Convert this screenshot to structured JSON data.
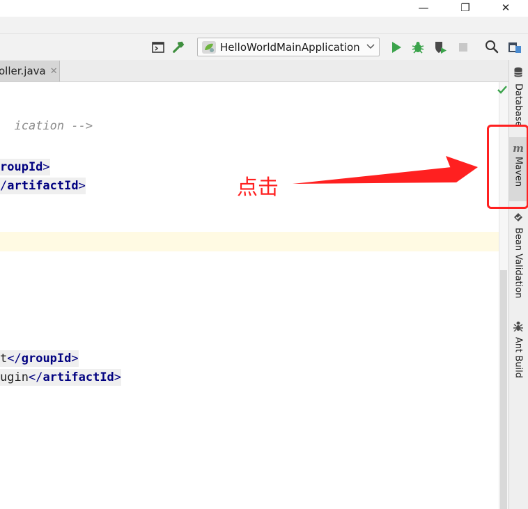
{
  "window": {
    "minimize_glyph": "—",
    "restore_glyph": "❐",
    "close_glyph": "✕"
  },
  "toolbar": {
    "run_config_label": "HelloWorldMainApplication",
    "icons": [
      "project-structure-icon",
      "build-icon",
      "spring-boot-icon",
      "run-icon",
      "debug-icon",
      "coverage-icon",
      "stop-icon",
      "search-icon",
      "project-view-icon"
    ]
  },
  "editor": {
    "tab_label": "oller.java",
    "tab_close": "✕",
    "lines": [
      {
        "comment": "ication -->"
      },
      {
        "tag": "roupId",
        "close": ">"
      },
      {
        "pre": "/",
        "tag": "artifactId",
        "close": ">"
      },
      {
        "text": "t",
        "open": "</",
        "tag": "groupId",
        "close": ">"
      },
      {
        "text": "ugin",
        "open": "</",
        "tag": "artifactId",
        "close": ">"
      }
    ]
  },
  "right_panel": {
    "tabs": [
      "Database",
      "Maven",
      "Bean Validation",
      "Ant Build"
    ]
  },
  "annotation": {
    "text": "点击",
    "color": "#ff2020"
  }
}
